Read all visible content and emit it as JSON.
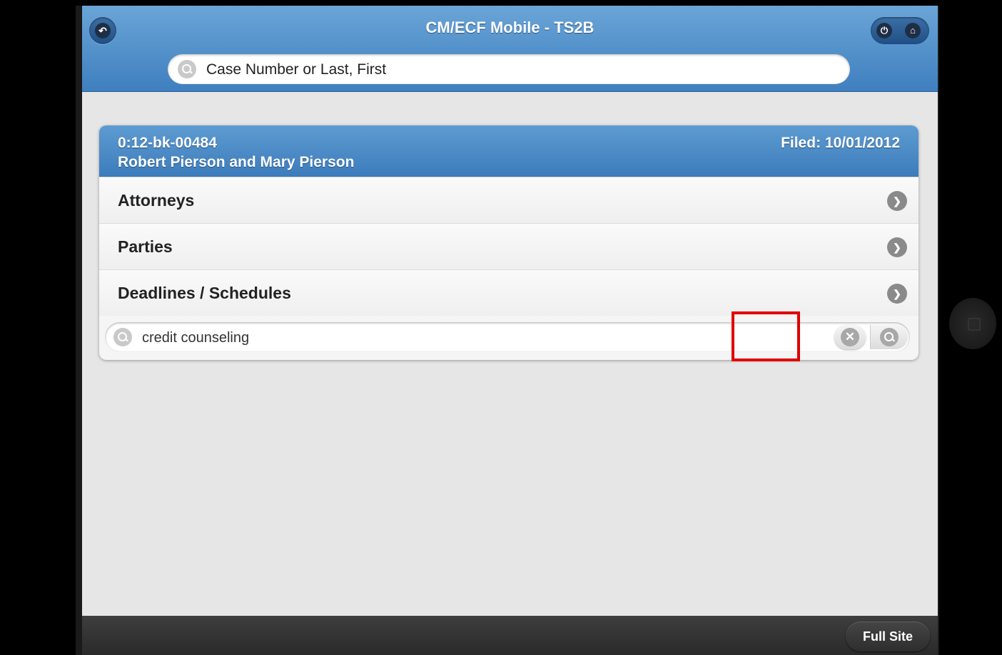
{
  "header": {
    "title": "CM/ECF Mobile - TS2B",
    "search_placeholder": "Case Number or Last, First"
  },
  "case": {
    "number": "0:12-bk-00484",
    "name": "Robert Pierson and Mary Pierson",
    "filed": "Filed: 10/01/2012"
  },
  "menu": {
    "items": [
      {
        "label": "Attorneys"
      },
      {
        "label": "Parties"
      },
      {
        "label": "Deadlines / Schedules"
      }
    ]
  },
  "filter": {
    "value": "credit counseling"
  },
  "footer": {
    "full_site_label": "Full Site"
  },
  "icons": {
    "back": "back-icon",
    "power": "power-icon",
    "home": "home-icon",
    "search": "search-icon",
    "clear": "clear-icon",
    "arrow": "chevron-right-icon"
  },
  "colors": {
    "header_blue": "#4f8fcb",
    "highlight_red": "#e00000",
    "footer_dark": "#333333"
  }
}
